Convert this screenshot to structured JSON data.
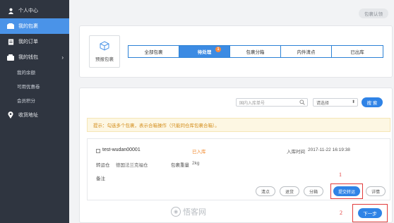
{
  "sidebar": {
    "items": [
      {
        "label": "个人中心",
        "icon": "user-icon"
      },
      {
        "label": "我的包裹",
        "icon": "package-icon",
        "active": true
      },
      {
        "label": "我的订单",
        "icon": "order-icon"
      },
      {
        "label": "我的钱包",
        "icon": "wallet-icon"
      }
    ],
    "wallet_sub": [
      "我的余额",
      "可用优惠卷",
      "会员积分"
    ],
    "address": {
      "label": "收货地址",
      "icon": "location-icon"
    }
  },
  "top_button": "包裹认领",
  "preview": {
    "label": "预报包裹",
    "icon": "box-icon"
  },
  "tabs": [
    {
      "label": "全部包裹"
    },
    {
      "label": "待处理",
      "active": true,
      "badge": "1"
    },
    {
      "label": "包裹分箱"
    },
    {
      "label": "内件清点"
    },
    {
      "label": "已出库"
    }
  ],
  "search": {
    "placeholder": "国内入库单号",
    "select_value": "请选择",
    "button": "搜 索"
  },
  "hint": "提示：勾选多个包裹，表示合箱操作（只能同仓库包裹合箱）。",
  "package": {
    "id": "test-wudan00001",
    "status": "已入库",
    "in_time_label": "入库时间",
    "in_time": "2017-11-22 16:19:38",
    "warehouse_label": "转运仓",
    "warehouse": "德国法兰克福仓",
    "weight_label": "包裹重量",
    "weight": "2kg",
    "note_label": "备注",
    "buttons": {
      "clear": "清点",
      "return": "退货",
      "split": "分箱",
      "submit": "提交转运",
      "detail": "详情"
    }
  },
  "annotations": {
    "one": "1",
    "two": "2"
  },
  "next_button": "下一步",
  "watermark": "悟客网",
  "colors": {
    "sidebar": "#2f3540",
    "accent": "#2f83e6",
    "highlight": "#e23b3b",
    "status": "#f2892d"
  }
}
